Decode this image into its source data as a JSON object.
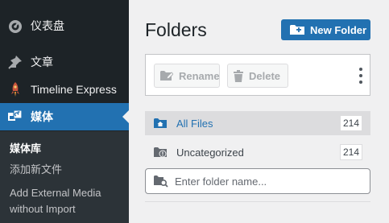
{
  "colors": {
    "sidebar_bg": "#1d2327",
    "submenu_bg": "#2c3338",
    "accent": "#2271b1",
    "panel_bg": "#f0f0f1"
  },
  "sidebar": {
    "items": [
      {
        "label": "仪表盘",
        "icon": "dashboard-icon"
      },
      {
        "label": "文章",
        "icon": "pushpin-icon"
      },
      {
        "label": "Timeline Express",
        "icon": "timeline-express-icon"
      },
      {
        "label": "媒体",
        "icon": "media-icon",
        "active": true
      }
    ],
    "submenu": [
      {
        "label": "媒体库",
        "current": true
      },
      {
        "label": "添加新文件"
      },
      {
        "label": "Add External Media without Import"
      }
    ]
  },
  "folders_panel": {
    "title": "Folders",
    "new_folder_label": "New Folder",
    "rename_label": "Rename",
    "delete_label": "Delete",
    "folders": [
      {
        "label": "All Files",
        "count": "214",
        "icon": "home-folder-icon",
        "selected": true
      },
      {
        "label": "Uncategorized",
        "count": "214",
        "icon": "uncategorized-folder-icon"
      }
    ],
    "search_placeholder": "Enter folder name..."
  }
}
